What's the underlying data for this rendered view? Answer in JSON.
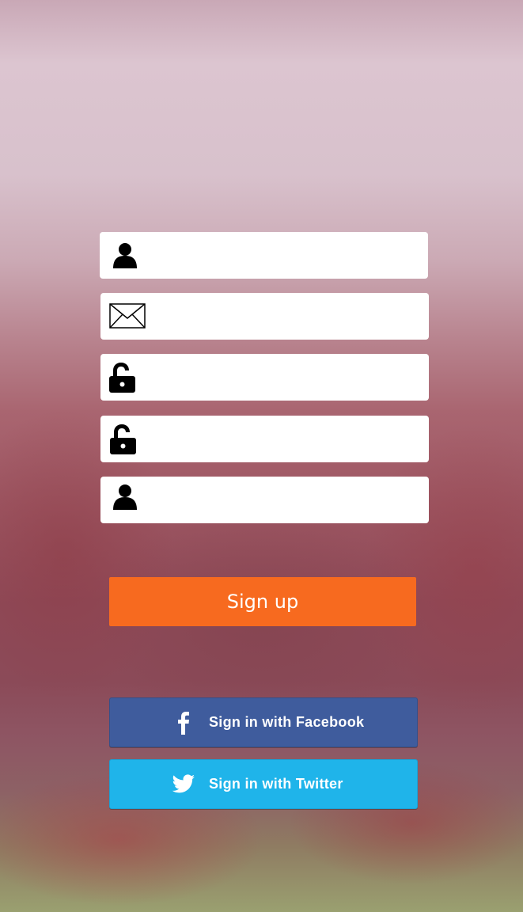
{
  "form": {
    "fields": [
      {
        "icon": "person-icon",
        "value": "",
        "placeholder": ""
      },
      {
        "icon": "envelope-icon",
        "value": "",
        "placeholder": ""
      },
      {
        "icon": "unlocked-padlock-icon",
        "value": "",
        "placeholder": ""
      },
      {
        "icon": "unlocked-padlock-icon",
        "value": "",
        "placeholder": ""
      },
      {
        "icon": "person-icon",
        "value": "",
        "placeholder": ""
      }
    ]
  },
  "actions": {
    "signup_label": "Sign up",
    "facebook_label": "Sign in with Facebook",
    "twitter_label": "Sign in with Twitter"
  },
  "colors": {
    "signup": "#f76a1f",
    "facebook": "#3f5c9d",
    "twitter": "#1fb4ea",
    "field": "#ffffff"
  }
}
